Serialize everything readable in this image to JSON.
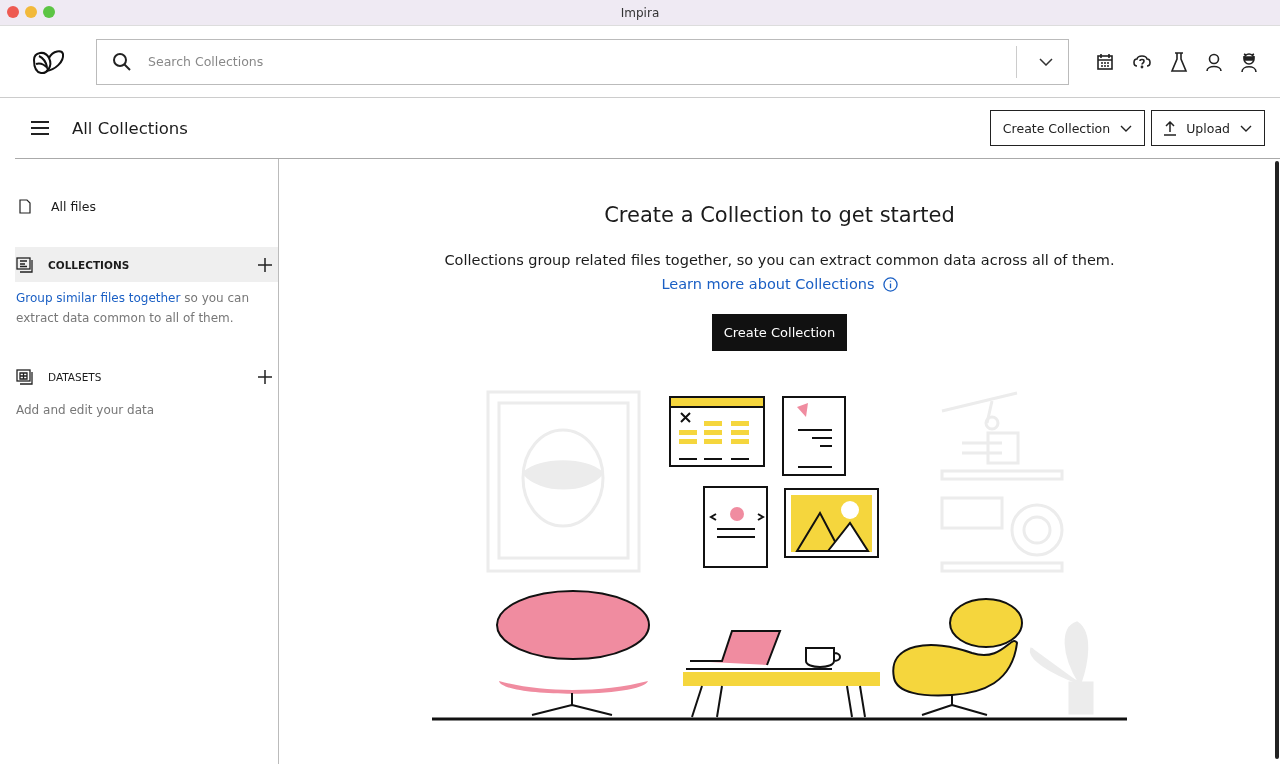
{
  "window": {
    "title": "Impira"
  },
  "search": {
    "placeholder": "Search Collections"
  },
  "page_header": {
    "title": "All Collections",
    "buttons": [
      {
        "label": "Create Collection",
        "kind": "plain"
      },
      {
        "label": "Upload",
        "kind": "upload"
      }
    ]
  },
  "sidebar": {
    "all_files": {
      "label": "All files"
    },
    "sections": [
      {
        "title": "COLLECTIONS",
        "kind": "collections",
        "selected": true,
        "link": "Group similar files together",
        "description": " so you can extract data common to all of them."
      },
      {
        "title": "DATASETS",
        "kind": "datasets",
        "selected": false,
        "description": "Add and edit your data"
      }
    ]
  },
  "empty_state": {
    "heading": "Create a Collection to get started",
    "text": "Collections group related files together, so you can extract common data across all of them.",
    "link": "Learn more about Collections",
    "button": "Create Collection"
  }
}
